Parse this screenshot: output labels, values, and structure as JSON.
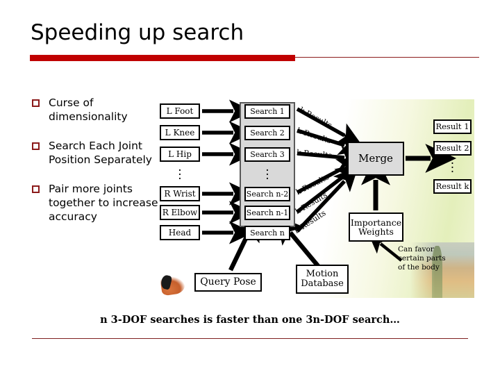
{
  "slide": {
    "title": "Speeding up search",
    "accent_color": "#c00000",
    "rule_color": "#8b1a1a",
    "caption": "n 3-DOF searches is faster than one 3n-DOF search…"
  },
  "bullets": [
    {
      "text": "Curse of dimensionality"
    },
    {
      "text": "Search Each Joint Position Separately"
    },
    {
      "text": "Pair more joints together to increase accuracy"
    }
  ],
  "diagram": {
    "joints": [
      "L Foot",
      "L Knee",
      "L Hip",
      "R Wrist",
      "R Elbow",
      "Head"
    ],
    "joints_ellipsis": "⋮",
    "searches": [
      "Search 1",
      "Search 2",
      "Search 3",
      "Search n-2",
      "Search n-1",
      "Search n"
    ],
    "searches_ellipsis": "⋮",
    "edge_labels": [
      "k Results",
      "k Results",
      "k Results",
      "k Results",
      "k Results",
      "k Results"
    ],
    "merge": "Merge",
    "importance_weights_line1": "Importance",
    "importance_weights_line2": "Weights",
    "query_pose": "Query Pose",
    "motion_database_line1": "Motion",
    "motion_database_line2": "Database",
    "results": [
      "Result 1",
      "Result 2",
      "Result k"
    ],
    "results_ellipsis": "⋮",
    "annotation_line1": "Can favor",
    "annotation_line2": "certain parts",
    "annotation_line3": "of the body"
  }
}
